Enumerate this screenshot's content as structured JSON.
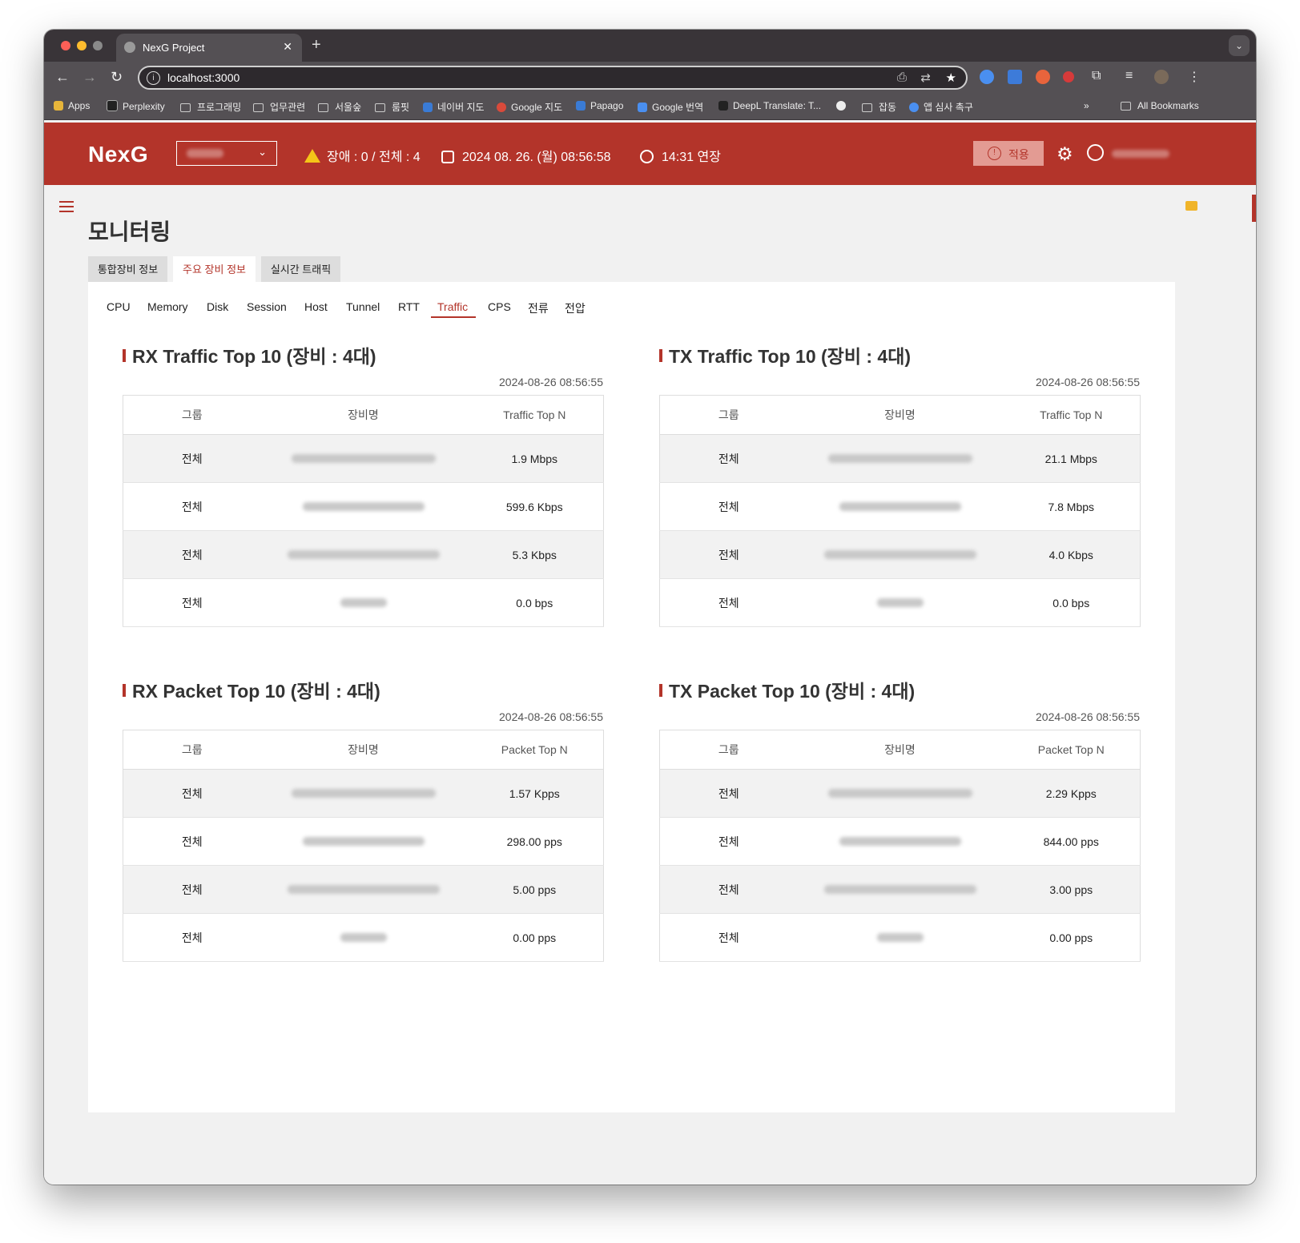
{
  "browser": {
    "tab_title": "NexG Project",
    "url": "localhost:3000",
    "bookmarks": [
      "Apps",
      "Perplexity",
      "프로그래밍",
      "업무관련",
      "서울숲",
      "룸핏",
      "네이버 지도",
      "Google 지도",
      "Papago",
      "Google 번역",
      "DeepL Translate: T...",
      "잡동",
      "앱 심사 촉구"
    ],
    "all_bookmarks": "All Bookmarks",
    "overflow": "»"
  },
  "header": {
    "logo": "NexG",
    "alarm": "장애 : 0 / 전체 : 4",
    "datetime": "2024 08. 26. (월) 08:56:58",
    "session": "14:31 연장",
    "apply_label": "적용"
  },
  "page": {
    "title": "모니터링",
    "tabs": [
      "통합장비 정보",
      "주요 장비 정보",
      "실시간 트래픽"
    ],
    "active_tab": "주요 장비 정보",
    "subnav": [
      "CPU",
      "Memory",
      "Disk",
      "Session",
      "Host",
      "Tunnel",
      "RTT",
      "Traffic",
      "CPS",
      "전류",
      "전압"
    ],
    "active_subnav": "Traffic"
  },
  "cards": [
    {
      "title": "RX Traffic Top 10 (장비 : 4대)",
      "timestamp": "2024-08-26 08:56:55",
      "columns": [
        "그룹",
        "장비명",
        "Traffic Top N"
      ],
      "rows": [
        {
          "group": "전체",
          "value": "1.9 Mbps"
        },
        {
          "group": "전체",
          "value": "599.6 Kbps"
        },
        {
          "group": "전체",
          "value": "5.3 Kbps"
        },
        {
          "group": "전체",
          "value": "0.0 bps"
        }
      ]
    },
    {
      "title": "TX Traffic Top 10 (장비 : 4대)",
      "timestamp": "2024-08-26 08:56:55",
      "columns": [
        "그룹",
        "장비명",
        "Traffic Top N"
      ],
      "rows": [
        {
          "group": "전체",
          "value": "21.1 Mbps"
        },
        {
          "group": "전체",
          "value": "7.8 Mbps"
        },
        {
          "group": "전체",
          "value": "4.0 Kbps"
        },
        {
          "group": "전체",
          "value": "0.0 bps"
        }
      ]
    },
    {
      "title": "RX Packet Top 10 (장비 : 4대)",
      "timestamp": "2024-08-26 08:56:55",
      "columns": [
        "그룹",
        "장비명",
        "Packet Top N"
      ],
      "rows": [
        {
          "group": "전체",
          "value": "1.57 Kpps"
        },
        {
          "group": "전체",
          "value": "298.00 pps"
        },
        {
          "group": "전체",
          "value": "5.00 pps"
        },
        {
          "group": "전체",
          "value": "0.00 pps"
        }
      ]
    },
    {
      "title": "TX Packet Top 10 (장비 : 4대)",
      "timestamp": "2024-08-26 08:56:55",
      "columns": [
        "그룹",
        "장비명",
        "Packet Top N"
      ],
      "rows": [
        {
          "group": "전체",
          "value": "2.29 Kpps"
        },
        {
          "group": "전체",
          "value": "844.00 pps"
        },
        {
          "group": "전체",
          "value": "3.00 pps"
        },
        {
          "group": "전체",
          "value": "0.00 pps"
        }
      ]
    }
  ],
  "colors": {
    "brand": "#b3342a",
    "warning": "#f5c518"
  }
}
